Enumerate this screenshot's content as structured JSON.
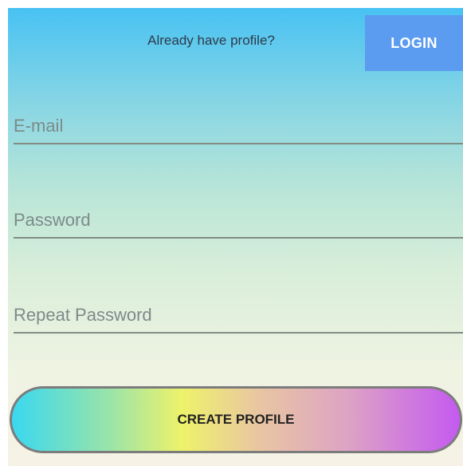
{
  "header": {
    "prompt": "Already have profile?",
    "login_label": "LOGIN"
  },
  "form": {
    "email_placeholder": "E-mail",
    "password_placeholder": "Password",
    "repeat_password_placeholder": "Repeat Password",
    "create_label": "CREATE PROFILE"
  },
  "colors": {
    "login_button": "#5b9cf0",
    "gradient_top": "#48c2f3",
    "gradient_bottom": "#f6f2e6"
  }
}
